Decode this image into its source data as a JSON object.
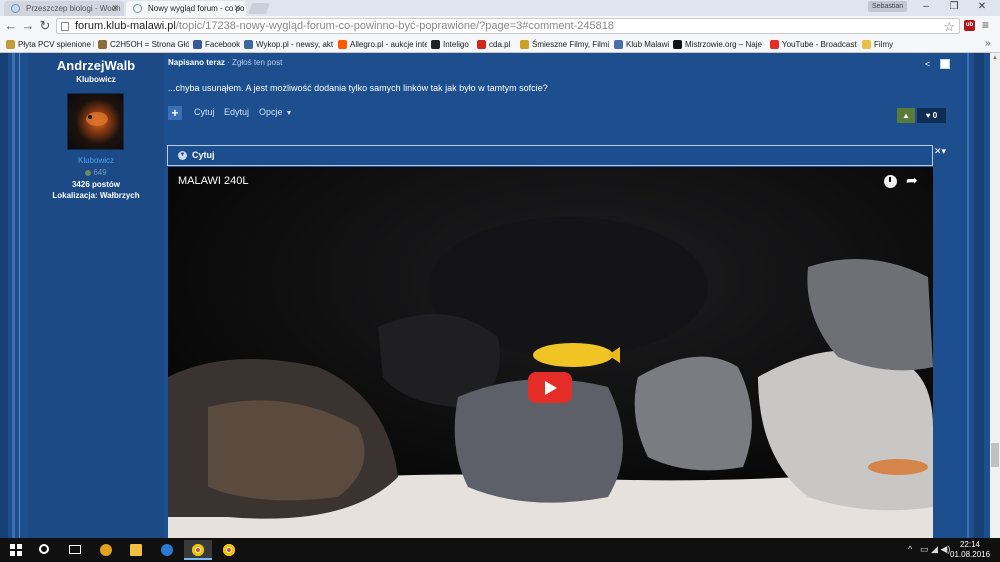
{
  "browser": {
    "tabs": [
      {
        "title": "Przeszczep biologi - Wodn"
      },
      {
        "title": "Nowy wygląd forum - co po"
      }
    ],
    "user_chip": "Sebastian",
    "window_controls": {
      "minimize": "–",
      "maximize": "❐",
      "close": "✕"
    },
    "nav": {
      "back": "←",
      "forward": "→",
      "reload": "↻"
    },
    "url_host": "forum.klub-malawi.pl",
    "url_path": "/topic/17238-nowy-wygląd-forum-co-powinno-być-poprawione/?page=3#comment-245818",
    "star": "☆",
    "extension_label": "ub",
    "menu_icon": "≡",
    "bookmarks": [
      {
        "label": "Płyta PCV spienione k",
        "color": "#c49a3a"
      },
      {
        "label": "C2H5OH = Strona Głó",
        "color": "#8a6d3b"
      },
      {
        "label": "Facebook",
        "color": "#3b5998"
      },
      {
        "label": "Wykop.pl - newsy, akt",
        "color": "#3b6aa0"
      },
      {
        "label": "Allegro.pl - aukcje inte",
        "color": "#ff5a00"
      },
      {
        "label": "Inteligo",
        "color": "#222222"
      },
      {
        "label": "cda.pl",
        "color": "#d0281d"
      },
      {
        "label": "Śmieszne Filmy, Filmi",
        "color": "#c9a227"
      },
      {
        "label": "Klub Malawi",
        "color": "#4a6ea8"
      },
      {
        "label": "Mistrzowie.org – Naje",
        "color": "#111111"
      },
      {
        "label": "YouTube - Broadcast",
        "color": "#e52d27"
      },
      {
        "label": "Filmy",
        "color": "#e8c04a"
      }
    ],
    "bookmarks_more": "»"
  },
  "post": {
    "author": {
      "name": "AndrzejWalb",
      "rank": "Klubowicz",
      "group": "Klubowicz",
      "reputation": "649",
      "posts": "3426 postów",
      "location": "Lokalizacja: Wałbrzych"
    },
    "meta": {
      "date": "Napisano teraz",
      "separator": "·",
      "report": "Zgłoś ten post"
    },
    "share_icon": "<",
    "text": "...chyba usunąłem. A jest możliwość dodania tylko samych linków tak jak było w tamtym sofcie?",
    "actions": {
      "plus": "+",
      "quote": "Cytuj",
      "edit": "Edytuj",
      "options": "Opcje",
      "options_caret": "▼"
    },
    "reaction": {
      "icon": "▲",
      "heart": "♥",
      "count": "0"
    }
  },
  "quote": {
    "icon": "▼",
    "label": "Cytuj",
    "controls": "✕▾",
    "video": {
      "title": "MALAWI 240L",
      "share_icon": "➦"
    }
  },
  "scrollbar": {
    "up": "▲"
  },
  "taskbar": {
    "items": [
      {
        "name": "start",
        "active": false
      },
      {
        "name": "search",
        "active": false
      },
      {
        "name": "task-view",
        "active": false
      },
      {
        "name": "app-color",
        "active": false
      },
      {
        "name": "explorer",
        "active": false
      },
      {
        "name": "app-blue",
        "active": false
      },
      {
        "name": "chrome",
        "active": true
      },
      {
        "name": "chrome-2",
        "active": false
      }
    ],
    "tray": {
      "chevron": "^",
      "icons": "▭ ◢ ◀)"
    },
    "time": "22:14",
    "date": "01.08.2016"
  }
}
